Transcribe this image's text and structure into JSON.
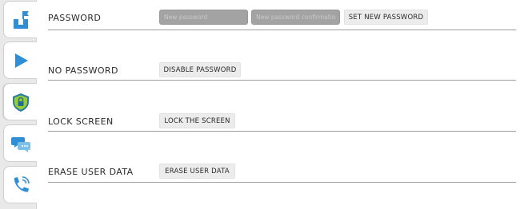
{
  "sidebar": {
    "items": [
      {
        "icon": "app-install-icon",
        "color": "#2f8fd6"
      },
      {
        "icon": "play-icon",
        "color": "#2f8fd6"
      },
      {
        "icon": "shield-lock-icon",
        "color": "#2a7fa8",
        "accent": "#9acd32"
      },
      {
        "icon": "chat-bubbles-icon",
        "color": "#2f8fd6"
      },
      {
        "icon": "phone-call-icon",
        "color": "#2f8fd6"
      }
    ]
  },
  "password": {
    "label": "PASSWORD",
    "new_placeholder": "New password",
    "confirm_placeholder": "New password confirmation",
    "set_button": "SET NEW PASSWORD"
  },
  "no_password": {
    "label": "NO PASSWORD",
    "button": "DISABLE PASSWORD"
  },
  "lock_screen": {
    "label": "LOCK SCREEN",
    "button": "LOCK THE SCREEN"
  },
  "erase": {
    "label": "ERASE USER DATA",
    "button": "ERASE USER DATA"
  },
  "colors": {
    "accent_blue": "#2f8fd6",
    "divider": "#9d9d9d",
    "input_bg": "#a3a3a3",
    "button_bg": "#ececec"
  }
}
